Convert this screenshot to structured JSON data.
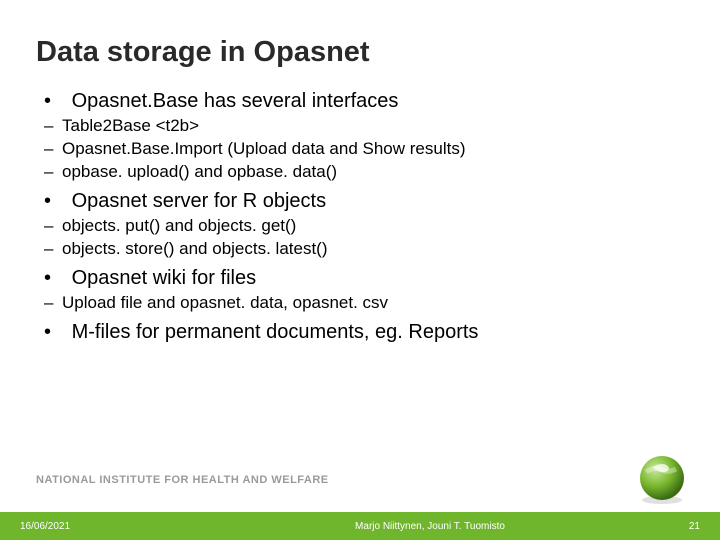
{
  "title": "Data storage in Opasnet",
  "bullets": [
    {
      "text": "Opasnet.Base has several interfaces",
      "sub": [
        "Table2Base <t2b>",
        "Opasnet.Base.Import (Upload data and Show results)",
        "opbase. upload() and opbase. data()"
      ]
    },
    {
      "text": "Opasnet server for R objects",
      "sub": [
        "objects. put() and objects. get()",
        "objects. store() and objects. latest()"
      ]
    },
    {
      "text": "Opasnet wiki for files",
      "sub": [
        "Upload file and opasnet. data, opasnet. csv"
      ]
    },
    {
      "text": "M-files for permanent documents, eg. Reports",
      "sub": []
    }
  ],
  "org": "NATIONAL INSTITUTE FOR HEALTH AND WELFARE",
  "footer": {
    "date": "16/06/2021",
    "center": "Marjo Niittynen, Jouni T. Tuomisto",
    "page": "21"
  }
}
